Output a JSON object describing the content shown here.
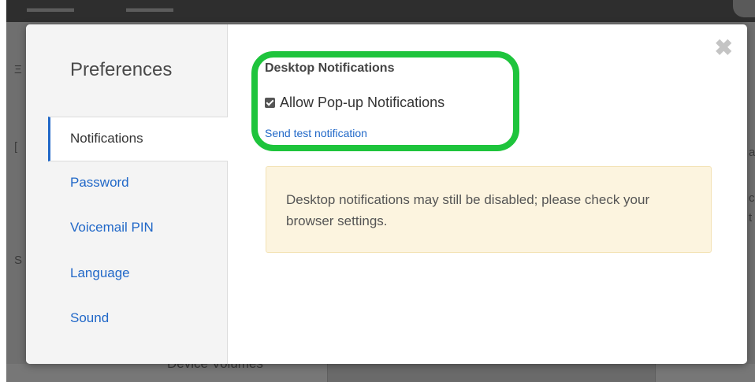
{
  "background": {
    "topbar_left": "",
    "bottom_label": "Device Volumes"
  },
  "modal": {
    "sidebar": {
      "title": "Preferences",
      "items": [
        {
          "label": "Notifications",
          "active": true
        },
        {
          "label": "Password",
          "active": false
        },
        {
          "label": "Voicemail PIN",
          "active": false
        },
        {
          "label": "Language",
          "active": false
        },
        {
          "label": "Sound",
          "active": false
        }
      ]
    },
    "content": {
      "heading": "Desktop Notifications",
      "checkbox_label": "Allow Pop-up Notifications",
      "checkbox_checked": true,
      "test_link": "Send test notification",
      "alert_text": "Desktop notifications may still be disabled; please check your browser settings."
    },
    "close_icon": "close-icon"
  },
  "colors": {
    "link": "#2168c8",
    "highlight": "#1ec43c",
    "alert_bg": "#fcf4df"
  }
}
